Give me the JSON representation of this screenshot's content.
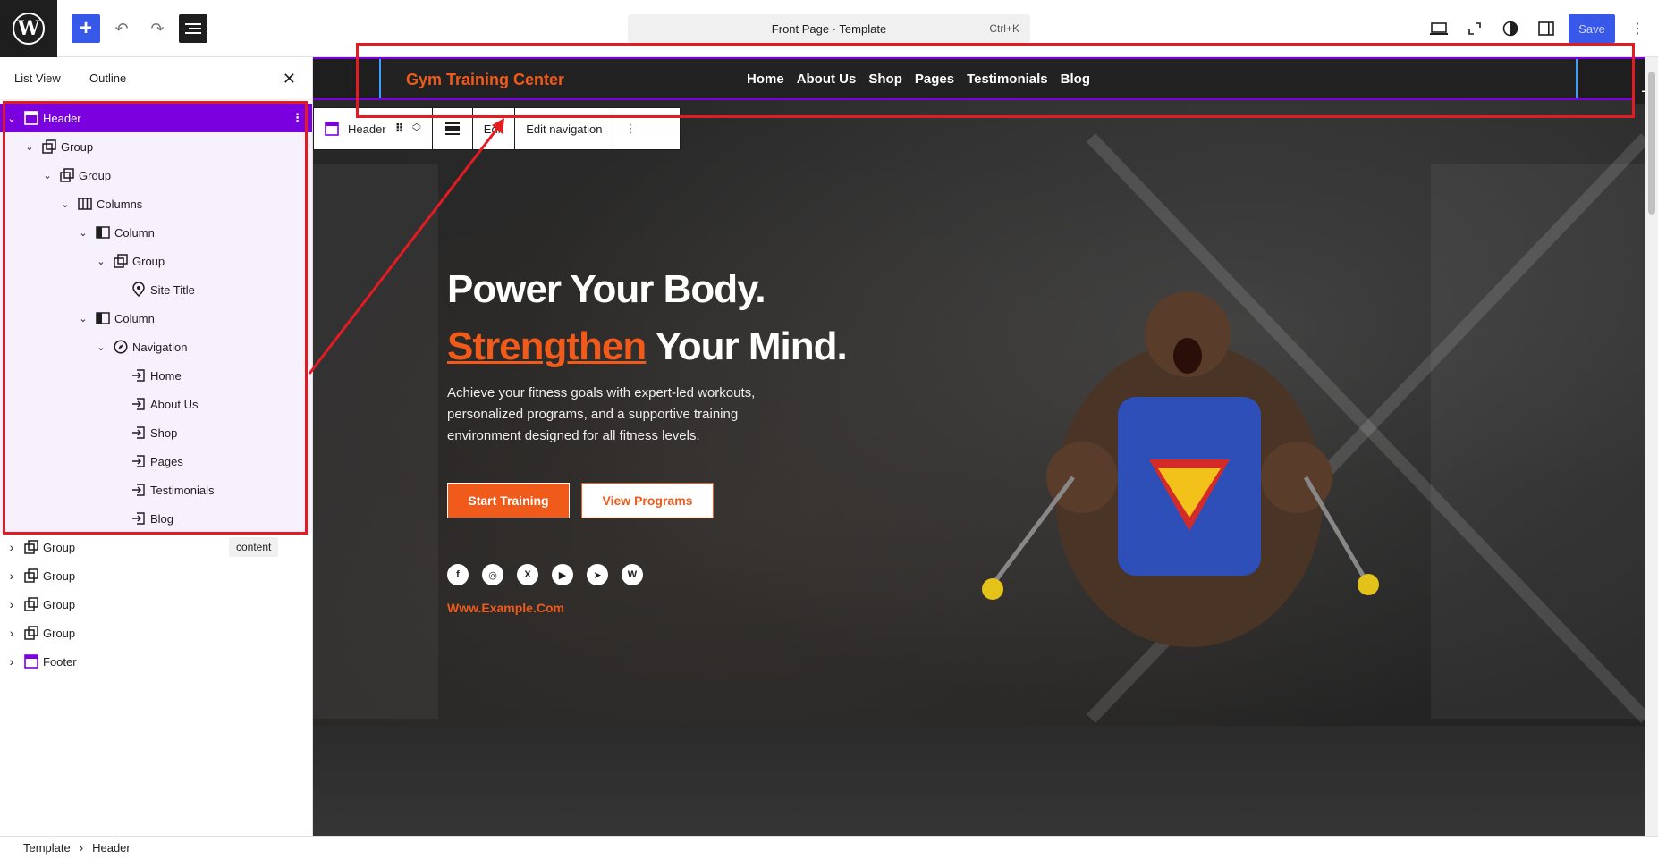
{
  "toolbar": {
    "add_icon": "plus-icon",
    "undo_icon": "undo-icon",
    "redo_icon": "redo-icon",
    "document_overview_icon": "list-icon",
    "document_title": "Front Page · Template",
    "shortcut": "Ctrl+K",
    "view_icon": "desktop-icon",
    "fullscreen_icon": "expand-icon",
    "styles_icon": "contrast-icon",
    "settings_icon": "sidebar-icon",
    "save_label": "Save",
    "options_icon": "more-vertical-icon"
  },
  "left_panel": {
    "tab_list_view": "List View",
    "tab_outline": "Outline",
    "close_icon": "close-icon",
    "content_badge": "content",
    "tree": [
      {
        "label": "Header",
        "icon": "template-part-icon",
        "level": 0,
        "expanded": true,
        "selected": true
      },
      {
        "label": "Group",
        "icon": "group-icon",
        "level": 1,
        "expanded": true
      },
      {
        "label": "Group",
        "icon": "group-icon",
        "level": 2,
        "expanded": true
      },
      {
        "label": "Columns",
        "icon": "columns-icon",
        "level": 3,
        "expanded": true
      },
      {
        "label": "Column",
        "icon": "column-icon",
        "level": 4,
        "expanded": true
      },
      {
        "label": "Group",
        "icon": "group-icon",
        "level": 5,
        "expanded": true
      },
      {
        "label": "Site Title",
        "icon": "map-marker-icon",
        "level": 6
      },
      {
        "label": "Column",
        "icon": "column-icon",
        "level": 4,
        "expanded": true
      },
      {
        "label": "Navigation",
        "icon": "navigation-icon",
        "level": 5,
        "expanded": true
      },
      {
        "label": "Home",
        "icon": "link-icon",
        "level": 6
      },
      {
        "label": "About Us",
        "icon": "link-icon",
        "level": 6
      },
      {
        "label": "Shop",
        "icon": "link-icon",
        "level": 6
      },
      {
        "label": "Pages",
        "icon": "link-icon",
        "level": 6
      },
      {
        "label": "Testimonials",
        "icon": "link-icon",
        "level": 6
      },
      {
        "label": "Blog",
        "icon": "link-icon",
        "level": 6
      },
      {
        "label": "Group",
        "icon": "group-icon",
        "level": 0,
        "collapsed": true
      },
      {
        "label": "Group",
        "icon": "group-icon",
        "level": 0,
        "collapsed": true
      },
      {
        "label": "Group",
        "icon": "group-icon",
        "level": 0,
        "collapsed": true
      },
      {
        "label": "Group",
        "icon": "group-icon",
        "level": 0,
        "collapsed": true
      },
      {
        "label": "Footer",
        "icon": "template-part-icon",
        "level": 0,
        "collapsed": true
      }
    ]
  },
  "canvas": {
    "site_title": "Gym Training Center",
    "nav": [
      "Home",
      "About Us",
      "Shop",
      "Pages",
      "Testimonials",
      "Blog"
    ],
    "block_toolbar": {
      "block_label": "Header",
      "drag_icon": "drag-handle-icon",
      "mover_icon": "chevron-up-down-icon",
      "align_icon": "align-icon",
      "edit": "Edit",
      "edit_navigation": "Edit navigation",
      "more_icon": "more-vertical-icon"
    },
    "hero": {
      "line1": "Power Your Body.",
      "highlight": "Strengthen",
      "line2_rest": " Your Mind.",
      "paragraph": "Achieve your fitness goals with expert-led workouts, personalized programs, and a supportive training environment designed for all fitness levels.",
      "btn_start": "Start Training",
      "btn_view": "View Programs",
      "socials": [
        "facebook-icon",
        "instagram-icon",
        "x-icon",
        "youtube-icon",
        "telegram-icon",
        "wordpress-icon"
      ],
      "url": "Www.Example.Com"
    }
  },
  "breadcrumb": [
    "Template",
    "Header"
  ],
  "colors": {
    "accent_orange": "#f05a1a",
    "selection_purple": "#7a00df",
    "wp_blue": "#3858e9",
    "annotation_red": "#e31b23"
  }
}
